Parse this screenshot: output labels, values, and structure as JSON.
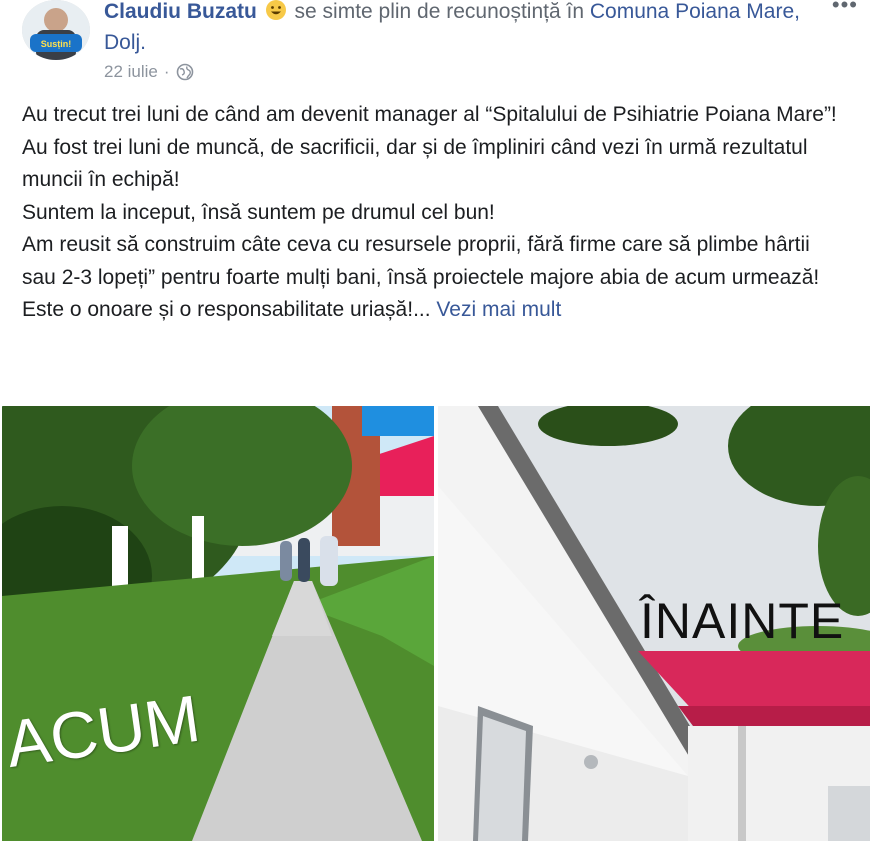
{
  "post": {
    "author": "Claudiu Buzatu",
    "activity": "se simte plin de recunoștință în",
    "location": "Comuna Poiana Mare, Dolj.",
    "date": "22 iulie",
    "date_separator": "·",
    "privacy_icon": "globe-icon",
    "more_label": "•••",
    "avatar_badge_text": "Susțin!"
  },
  "content": {
    "lines": [
      "Au trecut trei luni de când am devenit manager al “Spitalului de Psihiatrie Poiana Mare”!",
      "Au fost trei luni de muncă, de sacrificii, dar și de împliniri când vezi în urmă rezultatul muncii în echipă!",
      "Suntem la inceput, însă suntem pe drumul cel bun!",
      "Am reusit să construim câte ceva cu resursele proprii, fără firme care să plimbe hârtii sau 2-3 lopeți” pentru foarte mulți bani, însă proiectele majore abia de acum urmează!",
      "Este o onoare și o responsabilitate uriașă!..."
    ],
    "see_more": "Vezi mai mult"
  },
  "photos": {
    "left_label": "ACUM",
    "right_label": "ÎNAINTE"
  },
  "colors": {
    "link": "#385898",
    "secondary": "#606770",
    "roof_red": "#e0245e"
  }
}
